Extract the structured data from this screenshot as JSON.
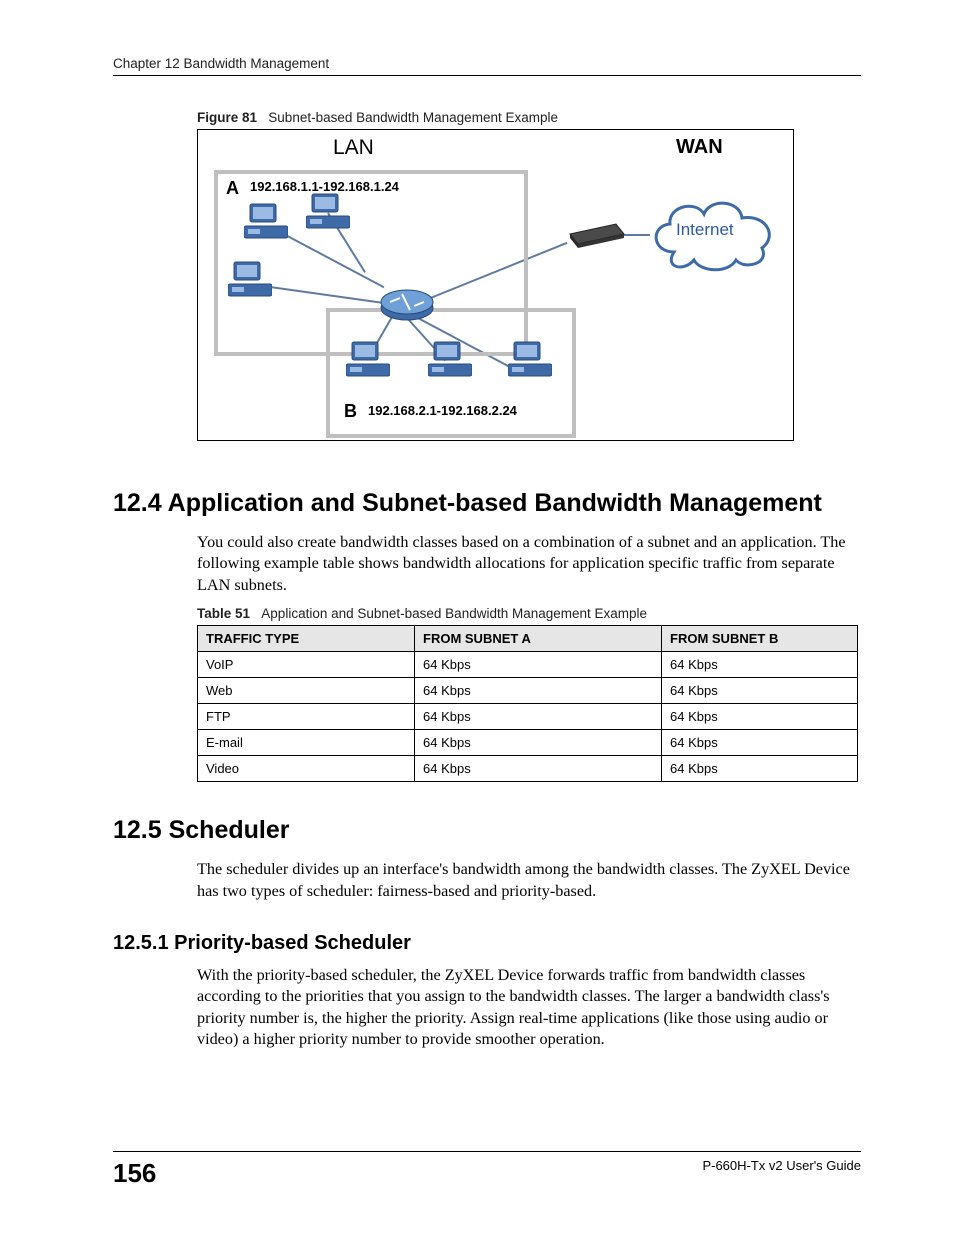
{
  "header": {
    "chapter_line": "Chapter 12 Bandwidth Management"
  },
  "figure": {
    "label": "Figure 81",
    "caption": "Subnet-based Bandwidth Management Example",
    "lan_label": "LAN",
    "wan_label": "WAN",
    "subnet_a_letter": "A",
    "subnet_a_range": "192.168.1.1-192.168.1.24",
    "subnet_b_letter": "B",
    "subnet_b_range": "192.168.2.1-192.168.2.24",
    "internet_label": "Internet"
  },
  "section_12_4": {
    "heading": "12.4  Application and Subnet-based Bandwidth Management",
    "paragraph": "You could also create bandwidth classes based on a combination of a subnet and an application. The following example table shows bandwidth allocations for application specific traffic from separate LAN subnets."
  },
  "table51": {
    "label": "Table 51",
    "caption": "Application and Subnet-based Bandwidth Management Example",
    "headers": [
      "TRAFFIC TYPE",
      "FROM SUBNET A",
      "FROM SUBNET B"
    ],
    "rows": [
      {
        "type": "VoIP",
        "a": "64 Kbps",
        "b": "64 Kbps"
      },
      {
        "type": "Web",
        "a": "64 Kbps",
        "b": "64 Kbps"
      },
      {
        "type": "FTP",
        "a": "64 Kbps",
        "b": "64 Kbps"
      },
      {
        "type": "E-mail",
        "a": "64 Kbps",
        "b": "64 Kbps"
      },
      {
        "type": "Video",
        "a": "64 Kbps",
        "b": "64 Kbps"
      }
    ]
  },
  "section_12_5": {
    "heading": "12.5  Scheduler",
    "paragraph": "The scheduler divides up an interface's bandwidth among the bandwidth classes. The ZyXEL Device has two types of scheduler: fairness-based and priority-based."
  },
  "section_12_5_1": {
    "heading": "12.5.1  Priority-based Scheduler",
    "paragraph": "With the priority-based scheduler, the ZyXEL Device forwards traffic from bandwidth classes according to the priorities that you assign to the bandwidth classes. The larger a bandwidth class's priority number is, the higher the priority. Assign real-time applications (like those using audio or video) a higher priority number to provide smoother operation."
  },
  "footer": {
    "page_number": "156",
    "guide": "P-660H-Tx v2 User's Guide"
  }
}
